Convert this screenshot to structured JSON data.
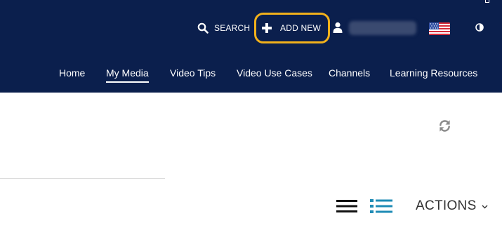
{
  "header": {
    "search_label": "SEARCH",
    "add_new_label": "ADD NEW",
    "username": "",
    "language_flag": "us-flag-icon",
    "contrast_toggle": "contrast-icon"
  },
  "nav": {
    "items": [
      {
        "label": "Home",
        "active": false
      },
      {
        "label": "My Media",
        "active": true
      },
      {
        "label": "Video Tips",
        "active": false
      },
      {
        "label": "Video Use Cases",
        "active": false
      },
      {
        "label": "Channels",
        "active": false
      },
      {
        "label": "Learning Resources",
        "active": false
      }
    ]
  },
  "toolbar": {
    "refresh_icon": "refresh-icon",
    "view_list_icon": "list-view-icon",
    "view_detailed_icon": "detailed-list-view-icon",
    "actions_label": "ACTIONS"
  },
  "colors": {
    "header_bg": "#0b1f4d",
    "focus_ring": "#f2b11b",
    "active_view": "#1e8bb5",
    "text_dark": "#333333"
  }
}
